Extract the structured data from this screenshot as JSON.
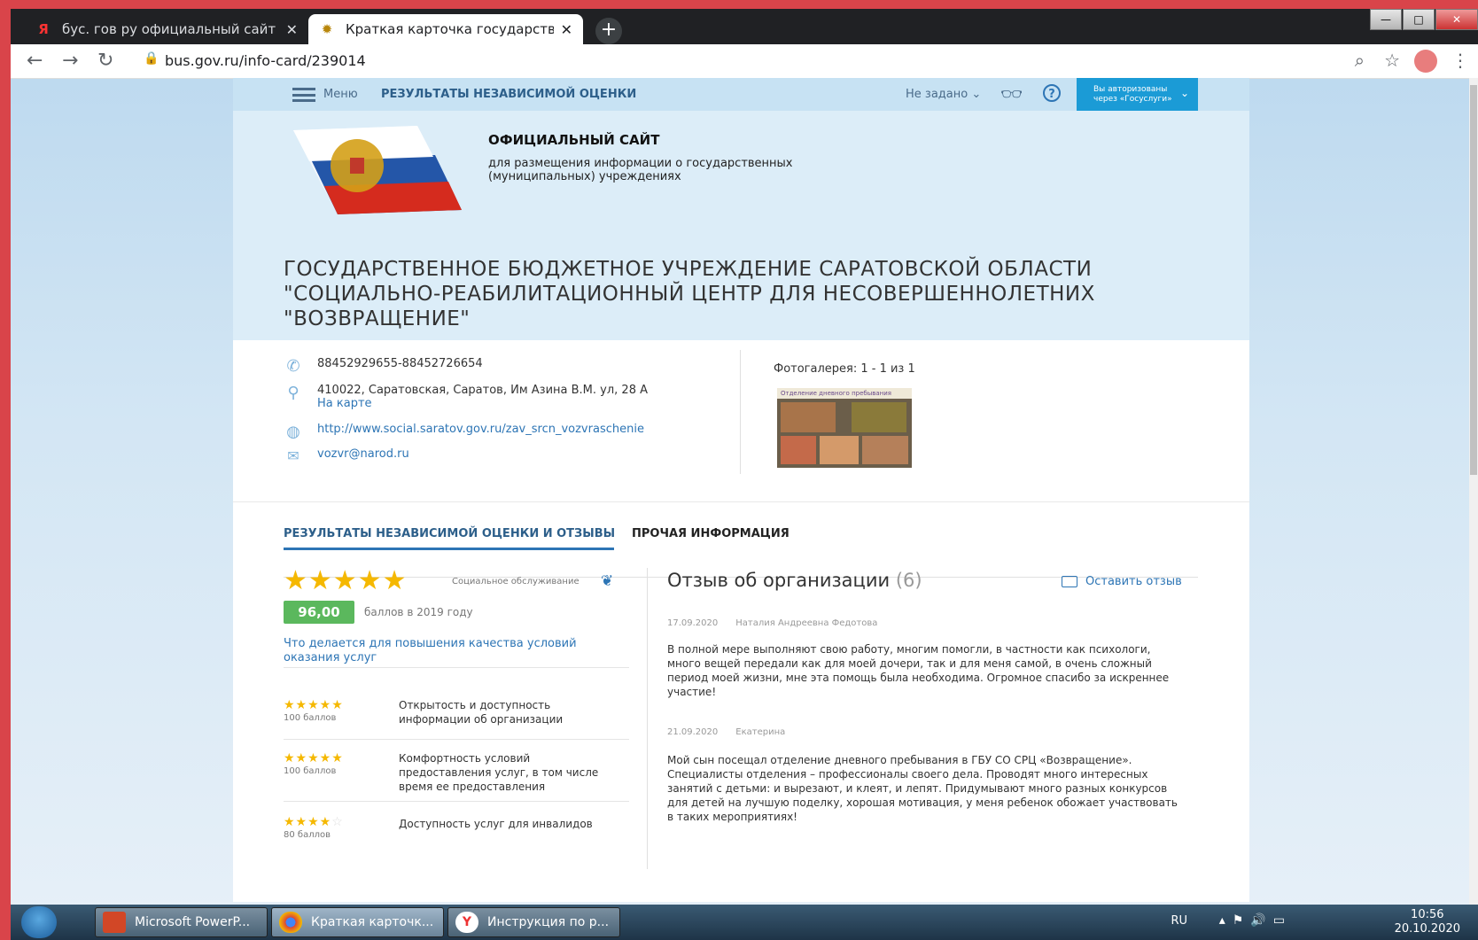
{
  "browser": {
    "tabs": [
      {
        "title": "бус. гов ру официальный сайт –",
        "icon": "yandex-icon",
        "active": false
      },
      {
        "title": "Краткая карточка государствен",
        "icon": "emblem-icon",
        "active": true
      }
    ],
    "new_tab": "+",
    "url": "bus.gov.ru/info-card/239014"
  },
  "site": {
    "menu_label": "Меню",
    "nav_title": "РЕЗУЛЬТАТЫ НЕЗАВИСИМОЙ ОЦЕНКИ",
    "region_select": "Не задано",
    "help_label": "?",
    "auth_line1": "Вы авторизованы",
    "auth_line2": "через «Госуслуги»",
    "title": "ОФИЦИАЛЬНЫЙ САЙТ",
    "subtitle": "для размещения информации о государственных (муниципальных) учреждениях",
    "organization": "ГОСУДАРСТВЕННОЕ БЮДЖЕТНОЕ УЧРЕЖДЕНИЕ САРАТОВСКОЙ ОБЛАСТИ \"СОЦИАЛЬНО-РЕАБИЛИТАЦИОННЫЙ ЦЕНТР ДЛЯ НЕСОВЕРШЕННОЛЕТНИХ \"ВОЗВРАЩЕНИЕ\""
  },
  "contacts": {
    "phone": "88452929655-88452726654",
    "address": "410022, Саратовская, Саратов, Им Азина В.М. ул, 28 А",
    "map_link": "На карте",
    "website": "http://www.social.saratov.gov.ru/zav_srcn_vozvraschenie",
    "email": "vozvr@narod.ru"
  },
  "gallery": {
    "label": "Фотогалерея: 1 - 1 из 1",
    "caption": "Отделение дневного пребывания"
  },
  "tabs": [
    {
      "label": "РЕЗУЛЬТАТЫ НЕЗАВИСИМОЙ ОЦЕНКИ И ОТЗЫВЫ",
      "active": true
    },
    {
      "label": "ПРОЧАЯ ИНФОРМАЦИЯ",
      "active": false
    }
  ],
  "rating": {
    "stars": 5,
    "service": "Социальное обслуживание",
    "score": "96,00",
    "score_note": "баллов в 2019 году",
    "improve_link": "Что делается для повышения качества условий оказания услуг",
    "criteria": [
      {
        "stars": 5,
        "points": "100 баллов",
        "text": "Открытость и доступность информации об организации"
      },
      {
        "stars": 5,
        "points": "100 баллов",
        "text": "Комфортность условий предоставления услуг, в том числе время ее предоставления"
      },
      {
        "stars": 4,
        "points": "80 баллов",
        "text": "Доступность услуг для инвалидов"
      }
    ]
  },
  "reviews": {
    "title": "Отзыв об организации",
    "count": "(6)",
    "leave_review": "Оставить отзыв",
    "items": [
      {
        "date": "17.09.2020",
        "author": "Наталия Андреевна Федотова",
        "text": "В полной мере выполняют свою работу, многим помогли, в частности как психологи, много вещей передали как для моей дочери, так и для меня самой, в очень сложный период моей жизни, мне эта помощь была необходима. Огромное спасибо за искреннее участие!"
      },
      {
        "date": "21.09.2020",
        "author": "Екатерина",
        "text": "Мой сын посещал отделение дневного пребывания в ГБУ СО СРЦ «Возвращение». Специалисты отделения – профессионалы своего дела. Проводят много интересных занятий с детьми: и вырезают, и клеят, и лепят. Придумывают много разных конкурсов для детей на лучшую поделку, хорошая мотивация, у меня ребенок обожает участвовать в таких мероприятиях!"
      }
    ]
  },
  "taskbar": {
    "items": [
      "Microsoft PowerP...",
      "Краткая карточк...",
      "Инструкция по р..."
    ],
    "lang": "RU",
    "time": "10:56",
    "date": "20.10.2020"
  },
  "colors": {
    "accent": "#2d75b5",
    "star": "#f5b800",
    "score_badge": "#5bb85d",
    "header_band": "#dcedf8"
  }
}
